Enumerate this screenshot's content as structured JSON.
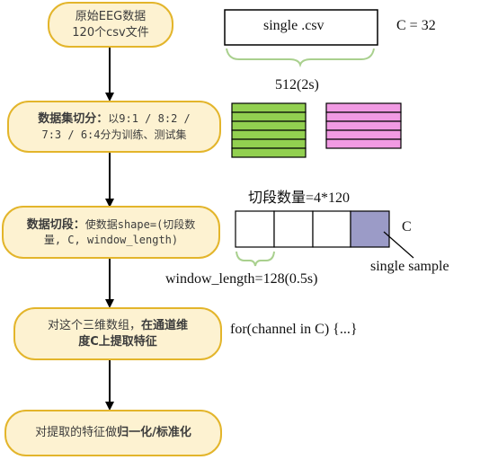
{
  "flow": {
    "step1": {
      "line1": "原始EEG数据",
      "line2": "120个csv文件"
    },
    "step2": {
      "bold": "数据集切分：",
      "text_a": "以9:1 / 8:2 /",
      "text_b": "7:3 / 6:4分为训练、测试集"
    },
    "step3": {
      "bold": "数据切段：",
      "text_a": "使数据shape=(切段数",
      "text_b": "量, C, window_length)"
    },
    "step4": {
      "text_a": "对这个三维数组，",
      "bold_a": "在通道维",
      "bold_b": "度C上提取特征"
    },
    "step5": {
      "text_a": "对提取的特征做",
      "bold_a": "归一化/标准化"
    }
  },
  "right": {
    "csv_label": "single .csv",
    "c_label": "C = 32",
    "length_label": "512(2s)",
    "segments_label": "切段数量=4*120",
    "c_small": "C",
    "sample_label": "single sample",
    "window_label": "window_length=128(0.5s)",
    "for_loop": "for(channel in C) {...}"
  },
  "colors": {
    "box_fill": "#fdf2d1",
    "box_border": "#e3b52b",
    "train_green": "#92d050",
    "test_pink": "#f19ae3",
    "sample_purple": "#9b9bc7",
    "brace_green": "#a9d08e"
  }
}
